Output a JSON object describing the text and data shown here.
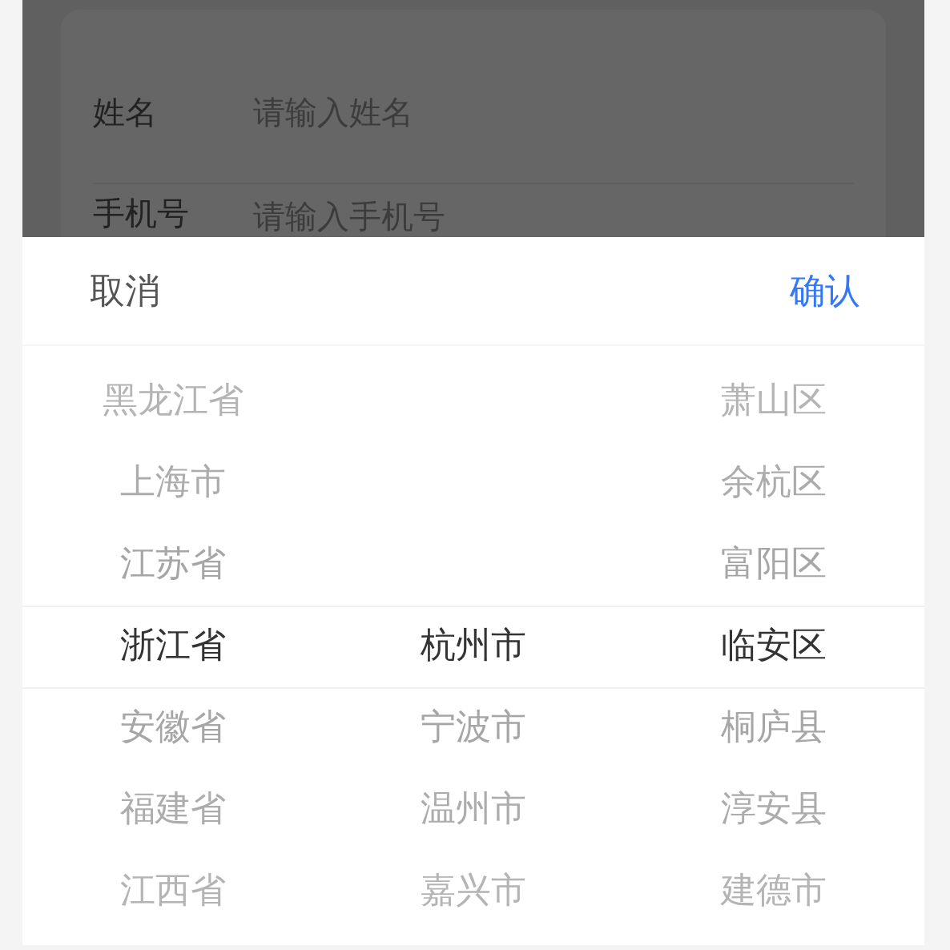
{
  "form": {
    "fields": [
      {
        "label": "姓名",
        "placeholder": "请输入姓名"
      },
      {
        "label": "手机号",
        "placeholder": "请输入手机号"
      }
    ]
  },
  "picker": {
    "cancel": "取消",
    "confirm": "确认",
    "columns": [
      {
        "items": [
          {
            "label": "黑龙江省",
            "selected": false
          },
          {
            "label": "上海市",
            "selected": false
          },
          {
            "label": "江苏省",
            "selected": false
          },
          {
            "label": "浙江省",
            "selected": true
          },
          {
            "label": "安徽省",
            "selected": false
          },
          {
            "label": "福建省",
            "selected": false
          },
          {
            "label": "江西省",
            "selected": false
          }
        ]
      },
      {
        "items": [
          {
            "label": "杭州市",
            "selected": true
          },
          {
            "label": "宁波市",
            "selected": false
          },
          {
            "label": "温州市",
            "selected": false
          },
          {
            "label": "嘉兴市",
            "selected": false
          }
        ]
      },
      {
        "items": [
          {
            "label": "萧山区",
            "selected": false
          },
          {
            "label": "余杭区",
            "selected": false
          },
          {
            "label": "富阳区",
            "selected": false
          },
          {
            "label": "临安区",
            "selected": true
          },
          {
            "label": "桐庐县",
            "selected": false
          },
          {
            "label": "淳安县",
            "selected": false
          },
          {
            "label": "建德市",
            "selected": false
          }
        ]
      }
    ]
  }
}
